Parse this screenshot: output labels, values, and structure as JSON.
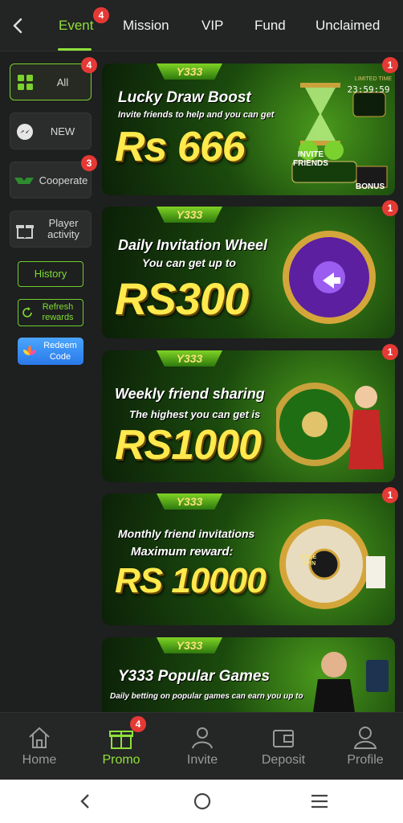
{
  "tabs": [
    {
      "label": "Event",
      "active": true,
      "badge": "4"
    },
    {
      "label": "Mission"
    },
    {
      "label": "VIP"
    },
    {
      "label": "Fund"
    },
    {
      "label": "Unclaimed"
    }
  ],
  "sidebar": {
    "items": [
      {
        "label": "All",
        "badge": "4",
        "icon": "grid-icon",
        "active": true
      },
      {
        "label": "NEW",
        "icon": "messenger-icon"
      },
      {
        "label": "Cooperate",
        "badge": "3",
        "icon": "handshake-icon"
      },
      {
        "label": "Player activity",
        "icon": "gift-icon"
      }
    ],
    "history_label": "History",
    "refresh_label": "Refresh rewards",
    "redeem_label": "Redeem Code"
  },
  "banners": [
    {
      "logo": "Y333",
      "headline": "Lucky Draw Boost",
      "subline": "Invite friends to help and you can get",
      "amount": "Rs 666",
      "extra": [
        "INVITE FRIENDS",
        "LIMITED TIME",
        "23:59:59",
        "BONUS"
      ],
      "badge": "1"
    },
    {
      "logo": "Y333",
      "headline": "Daily Invitation Wheel",
      "subline": "You can get up to",
      "amount": "RS300",
      "badge": "1"
    },
    {
      "logo": "Y333",
      "headline": "Weekly friend sharing",
      "subline": "The highest you can get is",
      "amount": "RS1000",
      "badge": "1"
    },
    {
      "logo": "Y333",
      "headline": "Monthly friend invitations",
      "subline": "Maximum reward:",
      "amount": "RS 10000",
      "extra": [
        "FREE SPIN"
      ],
      "badge": "1"
    },
    {
      "logo": "Y333",
      "headline": "Y333 Popular Games",
      "subline": "Daily betting on popular games can earn you up to"
    }
  ],
  "bottom_nav": [
    {
      "label": "Home",
      "icon": "home-icon"
    },
    {
      "label": "Promo",
      "icon": "gift-icon",
      "active": true,
      "badge": "4"
    },
    {
      "label": "Invite",
      "icon": "invite-icon"
    },
    {
      "label": "Deposit",
      "icon": "wallet-icon"
    },
    {
      "label": "Profile",
      "icon": "profile-icon"
    }
  ],
  "colors": {
    "accent": "#8fe03a",
    "badge": "#e53935",
    "background": "#1e1f1f"
  }
}
